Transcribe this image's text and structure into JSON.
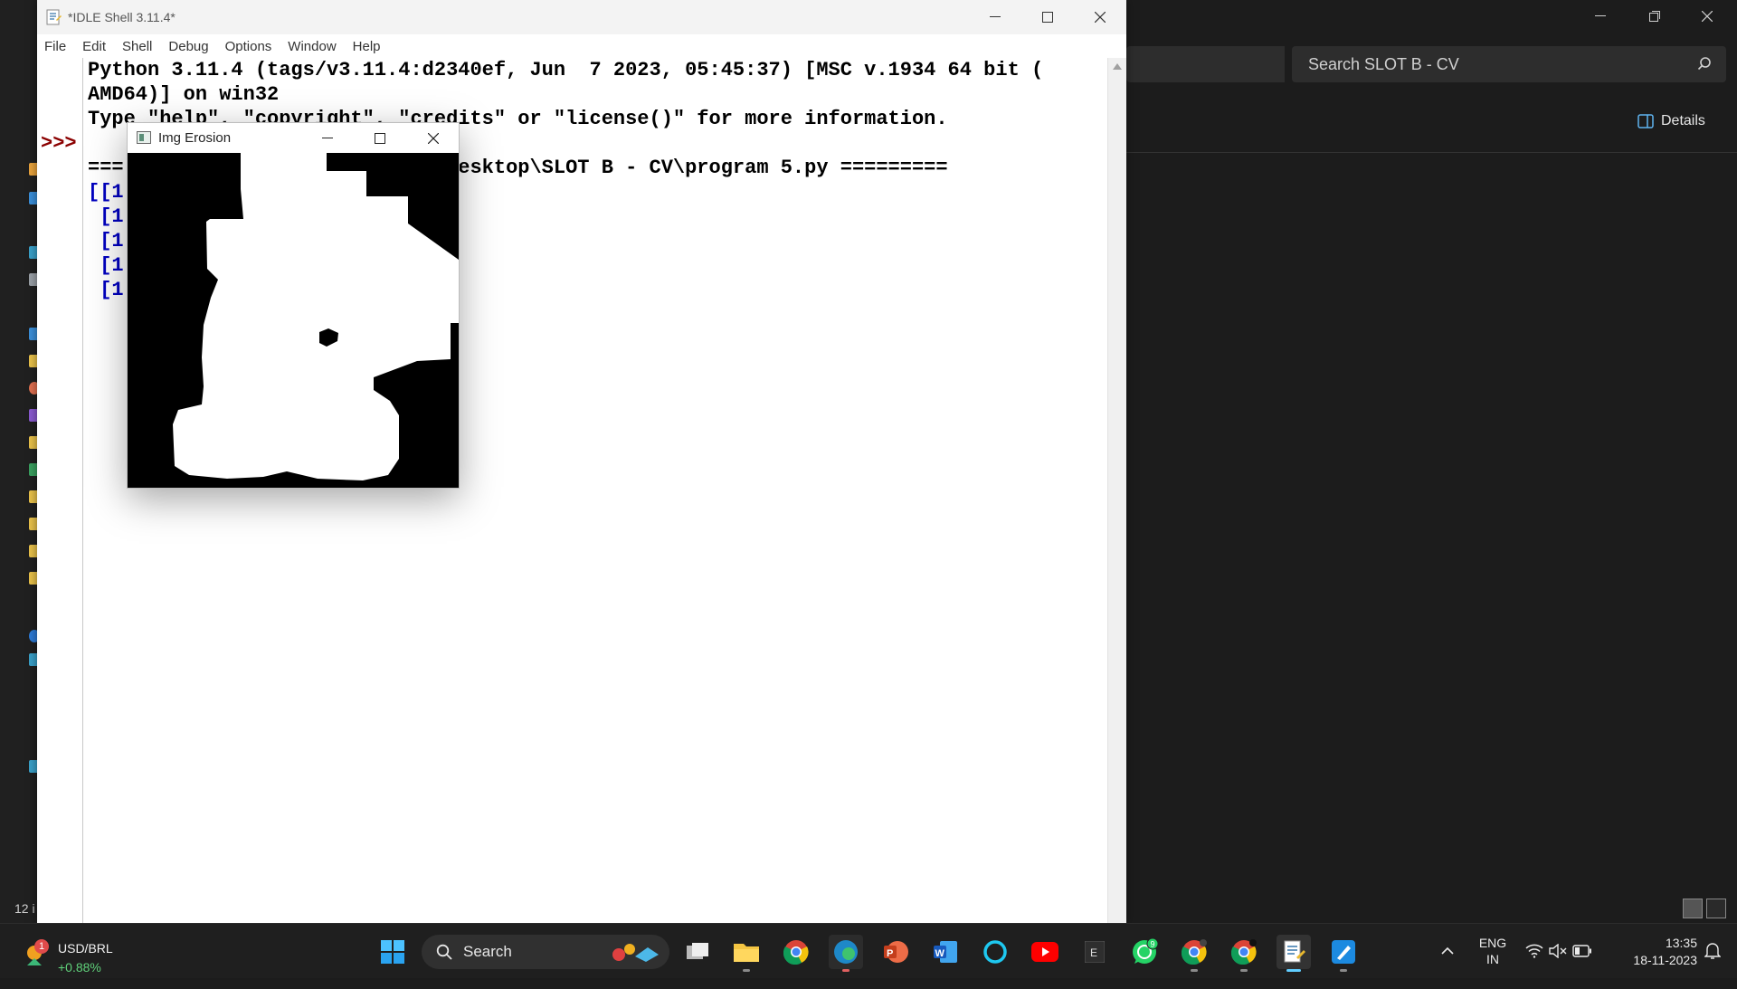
{
  "explorer": {
    "search_placeholder": "Search SLOT B - CV",
    "details_label": "Details",
    "status_items": "12 i"
  },
  "idle": {
    "title": "*IDLE Shell 3.11.4*",
    "menu": [
      "File",
      "Edit",
      "Shell",
      "Debug",
      "Options",
      "Window",
      "Help"
    ],
    "prompt": ">>>",
    "lines": [
      "Python 3.11.4 (tags/v3.11.4:d2340ef, Jun  7 2023, 05:45:37) [MSC v.1934 64 bit (",
      "AMD64)] on win32",
      "Type \"help\", \"copyright\", \"credits\" or \"license()\" for more information.",
      "",
      "===                  Srimathi\\Desktop\\SLOT B - CV\\program 5.py =========",
      "[[1",
      " [1",
      " [1",
      " [1",
      " [1"
    ]
  },
  "erosion_window": {
    "title": "Img Erosion"
  },
  "taskbar": {
    "ticker_name": "USD/BRL",
    "ticker_change": "+0.88%",
    "ticker_badge": "1",
    "search_label": "Search",
    "whatsapp_badge": "9",
    "lang_line1": "ENG",
    "lang_line2": "IN",
    "time": "13:35",
    "date": "18-11-2023"
  },
  "colors": {
    "prompt": "#8b0000",
    "output_blue": "#0000c0",
    "taskbar_active": "#60cdff"
  }
}
